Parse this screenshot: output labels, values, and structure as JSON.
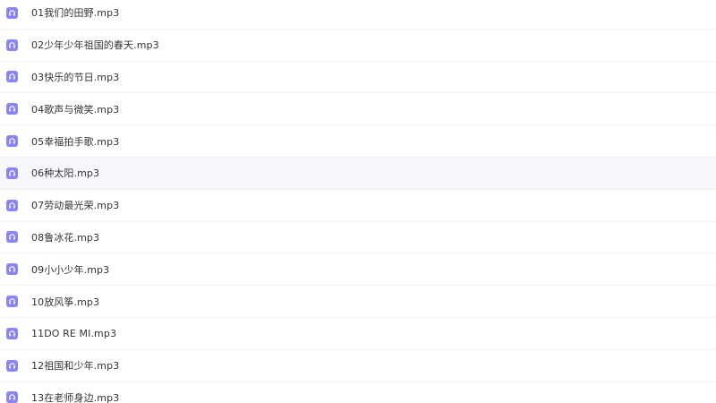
{
  "colors": {
    "icon_bg": "#8b85f2",
    "icon_fg": "#ffffff",
    "row_hover_bg": "#f7f8fb",
    "divider": "#eef0f3",
    "text": "#333333"
  },
  "file_icon": "headphones-icon",
  "files": [
    {
      "name": "01我们的田野.mp3"
    },
    {
      "name": "02少年少年祖国的春天.mp3"
    },
    {
      "name": "03快乐的节日.mp3"
    },
    {
      "name": "04歌声与微笑.mp3"
    },
    {
      "name": "05幸福拍手歌.mp3"
    },
    {
      "name": "06种太阳.mp3",
      "hovered": true
    },
    {
      "name": "07劳动最光荣.mp3"
    },
    {
      "name": "08鲁冰花.mp3"
    },
    {
      "name": "09小小少年.mp3"
    },
    {
      "name": "10放风筝.mp3"
    },
    {
      "name": "11DO RE MI.mp3"
    },
    {
      "name": "12祖国和少年.mp3"
    },
    {
      "name": "13在老师身边.mp3"
    }
  ]
}
